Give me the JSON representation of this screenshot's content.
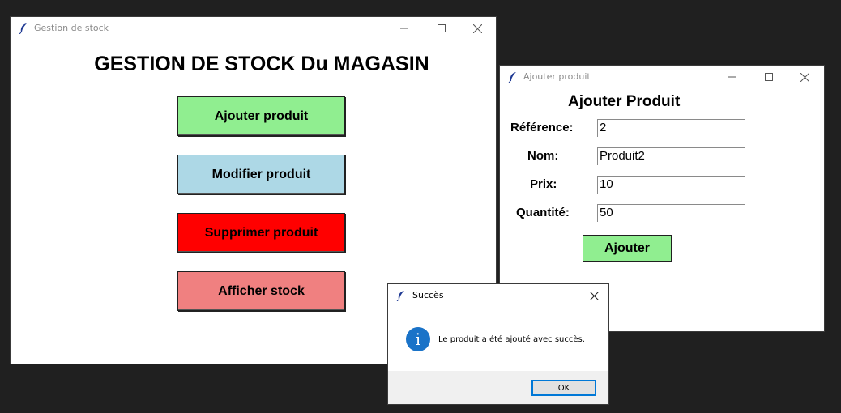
{
  "main_window": {
    "title": "Gestion de stock",
    "heading": "GESTION DE STOCK Du MAGASIN",
    "buttons": [
      {
        "label": "Ajouter produit",
        "color": "#90ee90"
      },
      {
        "label": "Modifier produit",
        "color": "#add8e6"
      },
      {
        "label": "Supprimer produit",
        "color": "#ff0000"
      },
      {
        "label": "Afficher stock",
        "color": "#f08080"
      }
    ]
  },
  "add_window": {
    "title": "Ajouter produit",
    "heading": "Ajouter Produit",
    "fields": [
      {
        "label": "Référence:",
        "value": "2"
      },
      {
        "label": "Nom:",
        "value": "Produit2"
      },
      {
        "label": "Prix:",
        "value": "10"
      },
      {
        "label": "Quantité:",
        "value": "50"
      }
    ],
    "submit_label": "Ajouter"
  },
  "success_dialog": {
    "title": "Succès",
    "icon": "info-icon",
    "message": "Le produit a été ajouté avec succès.",
    "ok_label": "OK"
  }
}
